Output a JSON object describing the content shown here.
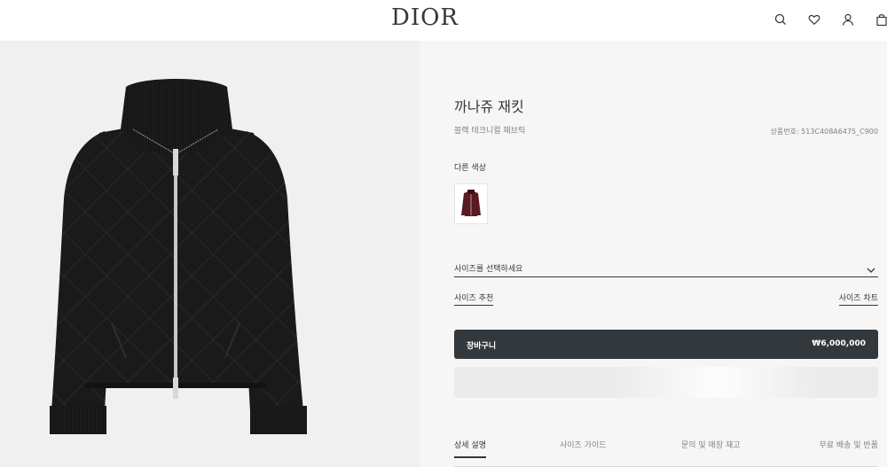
{
  "header": {
    "logo": "DIOR",
    "icons": [
      "search-icon",
      "heart-icon",
      "user-icon",
      "bag-icon"
    ]
  },
  "product": {
    "title": "까나쥬 재킷",
    "subtitle": "블랙 테크니컬 패브릭",
    "reference": "상품번호: 513C408A6475_C900",
    "other_colors_label": "다른 색상",
    "swatch_color": "#5a1a22"
  },
  "size": {
    "select_placeholder": "사이즈를 선택하세요",
    "recommend_label": "사이즈 추천",
    "chart_label": "사이즈 차트"
  },
  "cart": {
    "label": "장바구니",
    "price": "₩6,000,000"
  },
  "tabs": [
    {
      "label": "상세 설명",
      "active": true
    },
    {
      "label": "사이즈 가이드",
      "active": false
    },
    {
      "label": "문의 및 매장 재고",
      "active": false
    },
    {
      "label": "무료 배송 및 반품",
      "active": false
    }
  ],
  "colors": {
    "text": "#33383c",
    "muted": "#7b8487",
    "button_bg": "#33383c",
    "image_bg": "#f0f0f0",
    "panel_bg": "#f6f6f6"
  }
}
